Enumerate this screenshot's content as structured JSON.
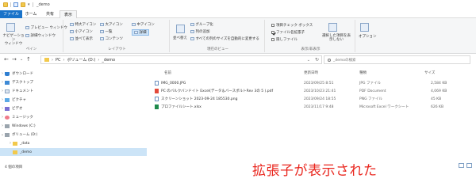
{
  "titlebar": {
    "title": "_demo"
  },
  "tabs": {
    "file": "ファイル",
    "home": "ホーム",
    "share": "共有",
    "view": "表示"
  },
  "ribbon": {
    "pane": {
      "preview": "プレビュー ウィンドウ",
      "details": "詳細ウィンドウ",
      "nav_pane": "ナビゲーション\nウィンドウ",
      "label": "ペイン"
    },
    "layout": {
      "xl_icons": "特大アイコン",
      "large_icons": "大アイコン",
      "medium_icons": "中アイコン",
      "small_icons": "小アイコン",
      "list": "一覧",
      "details": "詳細",
      "tiles": "並べて表示",
      "content": "コンテンツ",
      "label": "レイアウト"
    },
    "current_view": {
      "sort": "並べ替え",
      "group": "グループ化",
      "add_col": "列の追加",
      "fit_cols": "すべての列のサイズを自動的に変更する",
      "label": "現在のビュー"
    },
    "show_hide": {
      "item_check": "項目チェック ボックス",
      "file_ext": "ファイル名拡張子",
      "hidden": "隠しファイル",
      "hide_selected": "選択した項目を表示しない",
      "options": "オプション",
      "label": "表示/非表示",
      "file_ext_checked": true
    }
  },
  "address": {
    "crumbs": [
      "PC",
      "ボリューム (D:)",
      "_demo"
    ],
    "search_placeholder": "_demoの検索"
  },
  "nav": {
    "items": [
      {
        "label": "ダウンロード",
        "icon": "download-icon"
      },
      {
        "label": "デスクトップ",
        "icon": "desktop-icon"
      },
      {
        "label": "ドキュメント",
        "icon": "documents-icon"
      },
      {
        "label": "ピクチャ",
        "icon": "pictures-icon"
      },
      {
        "label": "ビデオ",
        "icon": "video-icon"
      },
      {
        "label": "ミュージック",
        "icon": "music-icon"
      },
      {
        "label": "Windows (C:)",
        "icon": "drive-icon"
      },
      {
        "label": "ボリューム (D:)",
        "icon": "drive-icon"
      },
      {
        "label": "_data",
        "icon": "folder-icon"
      },
      {
        "label": "_demo",
        "icon": "folder-icon"
      }
    ]
  },
  "columns": {
    "name": "名前",
    "date": "更新日時",
    "type": "種類",
    "size": "サイズ"
  },
  "files": [
    {
      "name": "IMG_0000.JPG",
      "date": "2023/09/25 8:51",
      "type": "JPG ファイル",
      "size": "2,584 KB",
      "icon": "png"
    },
    {
      "name": "PC のバルクバンドイト Excel(データ＆バースポルトRev 3の 5 ).pdf",
      "date": "2023/10/23 21:41",
      "type": "PDF Document",
      "size": "4,069 KB",
      "icon": "pdf"
    },
    {
      "name": "スクリーンショット 2023-09-24 185530.png",
      "date": "2023/09/24 18:55",
      "type": "PNG ファイル",
      "size": "45 KB",
      "icon": "png"
    },
    {
      "name": "プロファイルシート.xlsx",
      "date": "2023/11/17 9:48",
      "type": "Microsoft Excel ワークシート",
      "size": "626 KB",
      "icon": "xls"
    }
  ],
  "status": {
    "count": "4 個の項目"
  },
  "annotation": "拡張子が表示された"
}
